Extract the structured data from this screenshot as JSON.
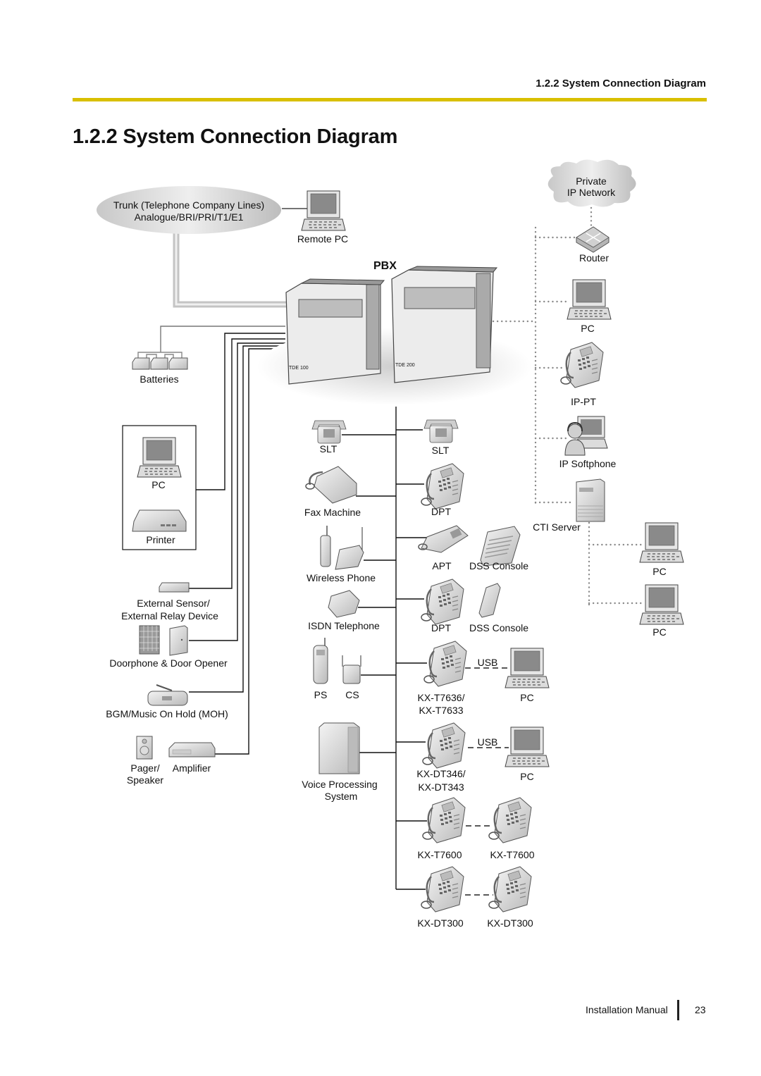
{
  "header": {
    "running_head": "1.2.2 System Connection Diagram",
    "rule_color": "#d9bf00",
    "title": "1.2.2  System Connection Diagram"
  },
  "diagram": {
    "trunk": {
      "line1": "Trunk (Telephone Company Lines)",
      "line2": "Analogue/BRI/PRI/T1/E1"
    },
    "remote_pc": "Remote PC",
    "pbx": "PBX",
    "pbx_units": [
      "TDE 100",
      "TDE 200"
    ],
    "private_network": {
      "line1": "Private",
      "line2": "IP Network"
    },
    "left_devices": {
      "batteries": "Batteries",
      "pc": "PC",
      "printer": "Printer",
      "external_sensor": {
        "line1": "External Sensor/",
        "line2": "External Relay Device"
      },
      "doorphone": "Doorphone & Door Opener",
      "bgm": "BGM/Music On Hold (MOH)",
      "pager": {
        "line1": "Pager/",
        "line2": "Speaker"
      },
      "amplifier": "Amplifier"
    },
    "center_left": {
      "slt": "SLT",
      "fax": "Fax Machine",
      "wireless": "Wireless Phone",
      "isdn": "ISDN Telephone",
      "ps": "PS",
      "cs": "CS",
      "vps": {
        "line1": "Voice Processing",
        "line2": "System"
      }
    },
    "center_right": {
      "slt": "SLT",
      "dpt1": "DPT",
      "apt": "APT",
      "dss1": "DSS Console",
      "dpt2": "DPT",
      "dss2": "DSS Console",
      "usb1": "USB",
      "kx_t7636": {
        "line1": "KX-T7636/",
        "line2": "KX-T7633"
      },
      "pc1": "PC",
      "usb2": "USB",
      "kx_dt346": {
        "line1": "KX-DT346/",
        "line2": "KX-DT343"
      },
      "pc2": "PC",
      "kx_t7600_a": "KX-T7600",
      "kx_t7600_b": "KX-T7600",
      "kx_dt300_a": "KX-DT300",
      "kx_dt300_b": "KX-DT300"
    },
    "ip_side": {
      "router": "Router",
      "pc": "PC",
      "ip_pt": "IP-PT",
      "ip_softphone": "IP Softphone",
      "cti_server": "CTI Server",
      "cti_pc1": "PC",
      "cti_pc2": "PC"
    }
  },
  "footer": {
    "manual": "Installation Manual",
    "page": "23"
  }
}
